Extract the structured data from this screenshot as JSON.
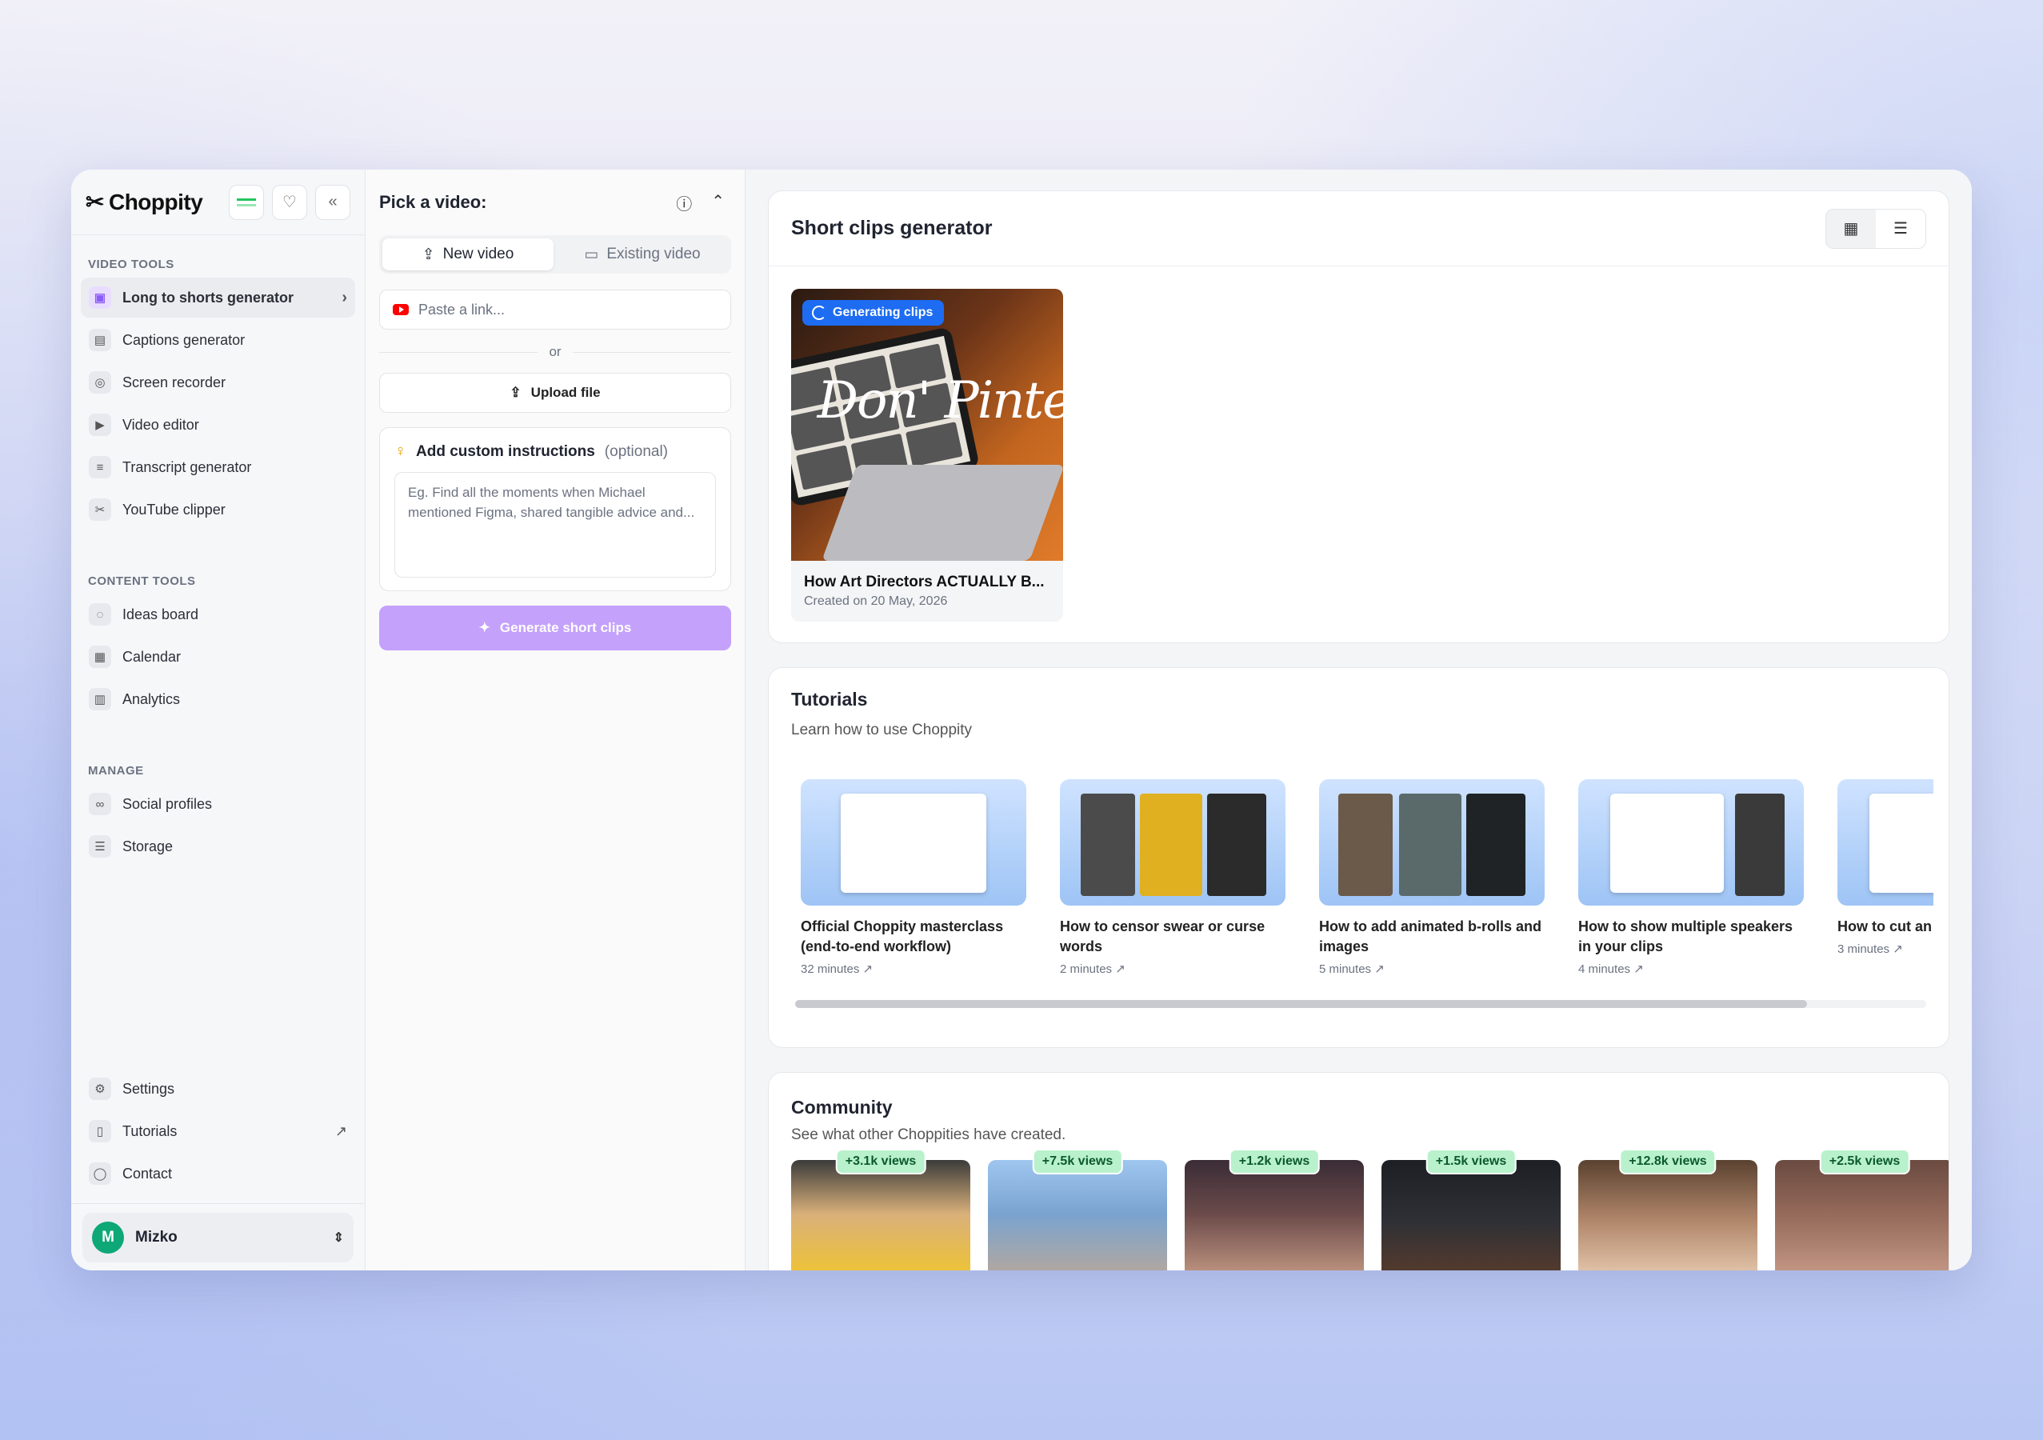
{
  "app": {
    "name": "Choppity"
  },
  "sidebar": {
    "sections": [
      {
        "label": "VIDEO TOOLS",
        "items": [
          {
            "label": "Long to shorts generator",
            "icon": "robot-icon",
            "active": true
          },
          {
            "label": "Captions generator",
            "icon": "captions-icon"
          },
          {
            "label": "Screen recorder",
            "icon": "screen-record-icon"
          },
          {
            "label": "Video editor",
            "icon": "monitor-play-icon"
          },
          {
            "label": "Transcript generator",
            "icon": "transcript-icon"
          },
          {
            "label": "YouTube clipper",
            "icon": "scissors-icon"
          }
        ]
      },
      {
        "label": "CONTENT TOOLS",
        "items": [
          {
            "label": "Ideas board",
            "icon": "lightbulb-icon"
          },
          {
            "label": "Calendar",
            "icon": "calendar-icon"
          },
          {
            "label": "Analytics",
            "icon": "bar-chart-icon"
          }
        ]
      },
      {
        "label": "MANAGE",
        "items": [
          {
            "label": "Social profiles",
            "icon": "link-icon"
          },
          {
            "label": "Storage",
            "icon": "database-icon"
          }
        ]
      }
    ],
    "bottom": [
      {
        "label": "Settings",
        "icon": "gear-icon"
      },
      {
        "label": "Tutorials",
        "icon": "book-icon"
      },
      {
        "label": "Contact",
        "icon": "chat-icon"
      }
    ],
    "user": {
      "initial": "M",
      "name": "Mizko"
    }
  },
  "picker": {
    "title": "Pick a video:",
    "tabs": [
      {
        "label": "New video"
      },
      {
        "label": "Existing video"
      }
    ],
    "link_placeholder": "Paste a link...",
    "or": "or",
    "upload": "Upload file",
    "instructions_title": "Add custom instructions",
    "instructions_optional": "(optional)",
    "instructions_placeholder": "Eg. Find all the moments when Michael mentioned Figma, shared tangible advice and...",
    "generate": "Generate short clips"
  },
  "clips": {
    "title": "Short clips generator",
    "items": [
      {
        "badge": "Generating clips",
        "overlay_text": "Don' Pinte",
        "title": "How Art Directors ACTUALLY B...",
        "date": "Created on 20 May, 2026"
      }
    ]
  },
  "tutorials": {
    "title": "Tutorials",
    "subtitle": "Learn how to use Choppity",
    "items": [
      {
        "title": "Official Choppity masterclass (end-to-end workflow)",
        "duration": "32 minutes"
      },
      {
        "title": "How to censor swear or curse words",
        "duration": "2 minutes"
      },
      {
        "title": "How to add animated b-rolls and images",
        "duration": "5 minutes"
      },
      {
        "title": "How to show multiple speakers in your clips",
        "duration": "4 minutes"
      },
      {
        "title": "How to cut an",
        "duration": "3 minutes"
      }
    ]
  },
  "community": {
    "title": "Community",
    "subtitle": "See what other Choppities have created.",
    "items": [
      {
        "views": "+3.1k views",
        "color": "#e8c13a"
      },
      {
        "views": "+7.5k views",
        "color": "#6aa0d8"
      },
      {
        "views": "+1.2k views",
        "color": "#4a3b44"
      },
      {
        "views": "+1.5k views",
        "color": "#2b2d33"
      },
      {
        "views": "+12.8k views",
        "color": "#8a5a3a"
      },
      {
        "views": "+2.5k views",
        "color": "#8b5e52"
      }
    ]
  }
}
